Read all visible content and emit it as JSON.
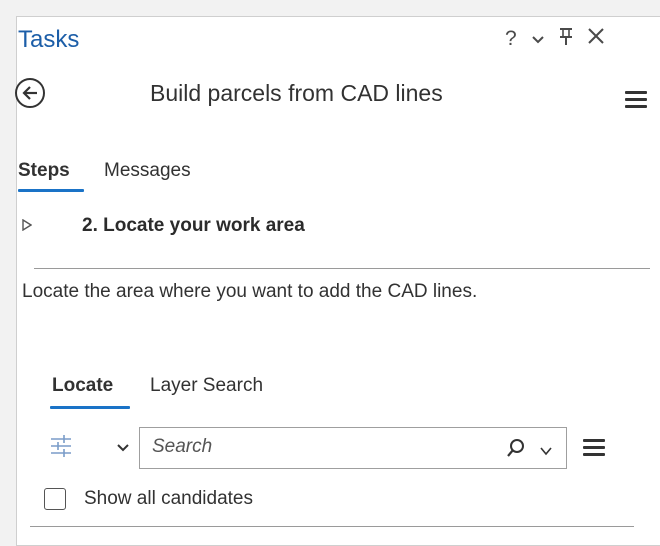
{
  "pane": {
    "title": "Tasks",
    "help_label": "?",
    "colors": {
      "title": "#1c5ea8",
      "accent": "#1a73c7"
    }
  },
  "task": {
    "name": "Build parcels from CAD lines",
    "tabs": [
      {
        "label": "Steps",
        "active": true
      },
      {
        "label": "Messages",
        "active": false
      }
    ],
    "step": {
      "label": "2.  Locate your work area"
    },
    "instruction": "Locate the area where you want to add the CAD lines."
  },
  "locate": {
    "tabs": [
      {
        "label": "Locate",
        "active": true
      },
      {
        "label": "Layer Search",
        "active": false
      }
    ],
    "search": {
      "placeholder": "Search",
      "value": ""
    },
    "show_all_candidates": {
      "label": "Show all candidates",
      "checked": false
    }
  },
  "icons": [
    "back-arrow-icon",
    "chevron-down-icon",
    "pin-icon",
    "close-icon",
    "menu-icon",
    "expand-triangle-icon",
    "filter-settings-icon",
    "search-icon"
  ]
}
